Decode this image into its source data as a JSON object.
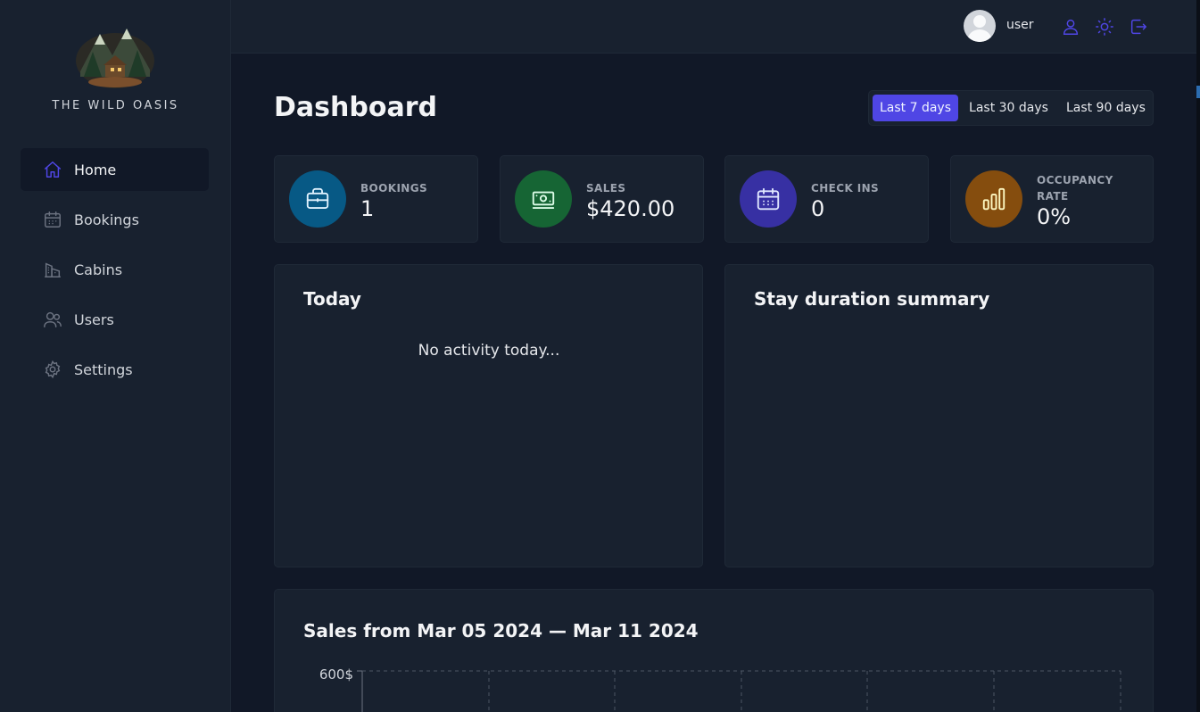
{
  "app": {
    "name": "THE WILD OASIS",
    "accent_color": "#4f46e5"
  },
  "sidebar": {
    "items": [
      {
        "label": "Home",
        "icon": "home-icon",
        "active": true
      },
      {
        "label": "Bookings",
        "icon": "calendar-icon",
        "active": false
      },
      {
        "label": "Cabins",
        "icon": "cabin-icon",
        "active": false
      },
      {
        "label": "Users",
        "icon": "users-icon",
        "active": false
      },
      {
        "label": "Settings",
        "icon": "gear-icon",
        "active": false
      }
    ]
  },
  "header": {
    "username": "user",
    "actions": [
      "user-icon",
      "sun-icon",
      "logout-icon"
    ]
  },
  "main": {
    "title": "Dashboard",
    "filters": [
      {
        "label": "Last 7 days",
        "active": true
      },
      {
        "label": "Last 30 days",
        "active": false
      },
      {
        "label": "Last 90 days",
        "active": false
      }
    ],
    "stats": [
      {
        "label": "BOOKINGS",
        "value": "1",
        "icon": "briefcase-icon",
        "color": "#075985"
      },
      {
        "label": "SALES",
        "value": "$420.00",
        "icon": "banknotes-icon",
        "color": "#166534"
      },
      {
        "label": "CHECK INS",
        "value": "0",
        "icon": "calendar-days-icon",
        "color": "#3730a3"
      },
      {
        "label": "OCCUPANCY RATE",
        "value": "0%",
        "icon": "chart-bar-icon",
        "color": "#854d0e"
      }
    ],
    "today": {
      "title": "Today",
      "empty_text": "No activity today..."
    },
    "stay_duration": {
      "title": "Stay duration summary"
    },
    "sales": {
      "title": "Sales from Mar 05 2024 — Mar 11 2024",
      "y_tick_top": "600$"
    }
  }
}
